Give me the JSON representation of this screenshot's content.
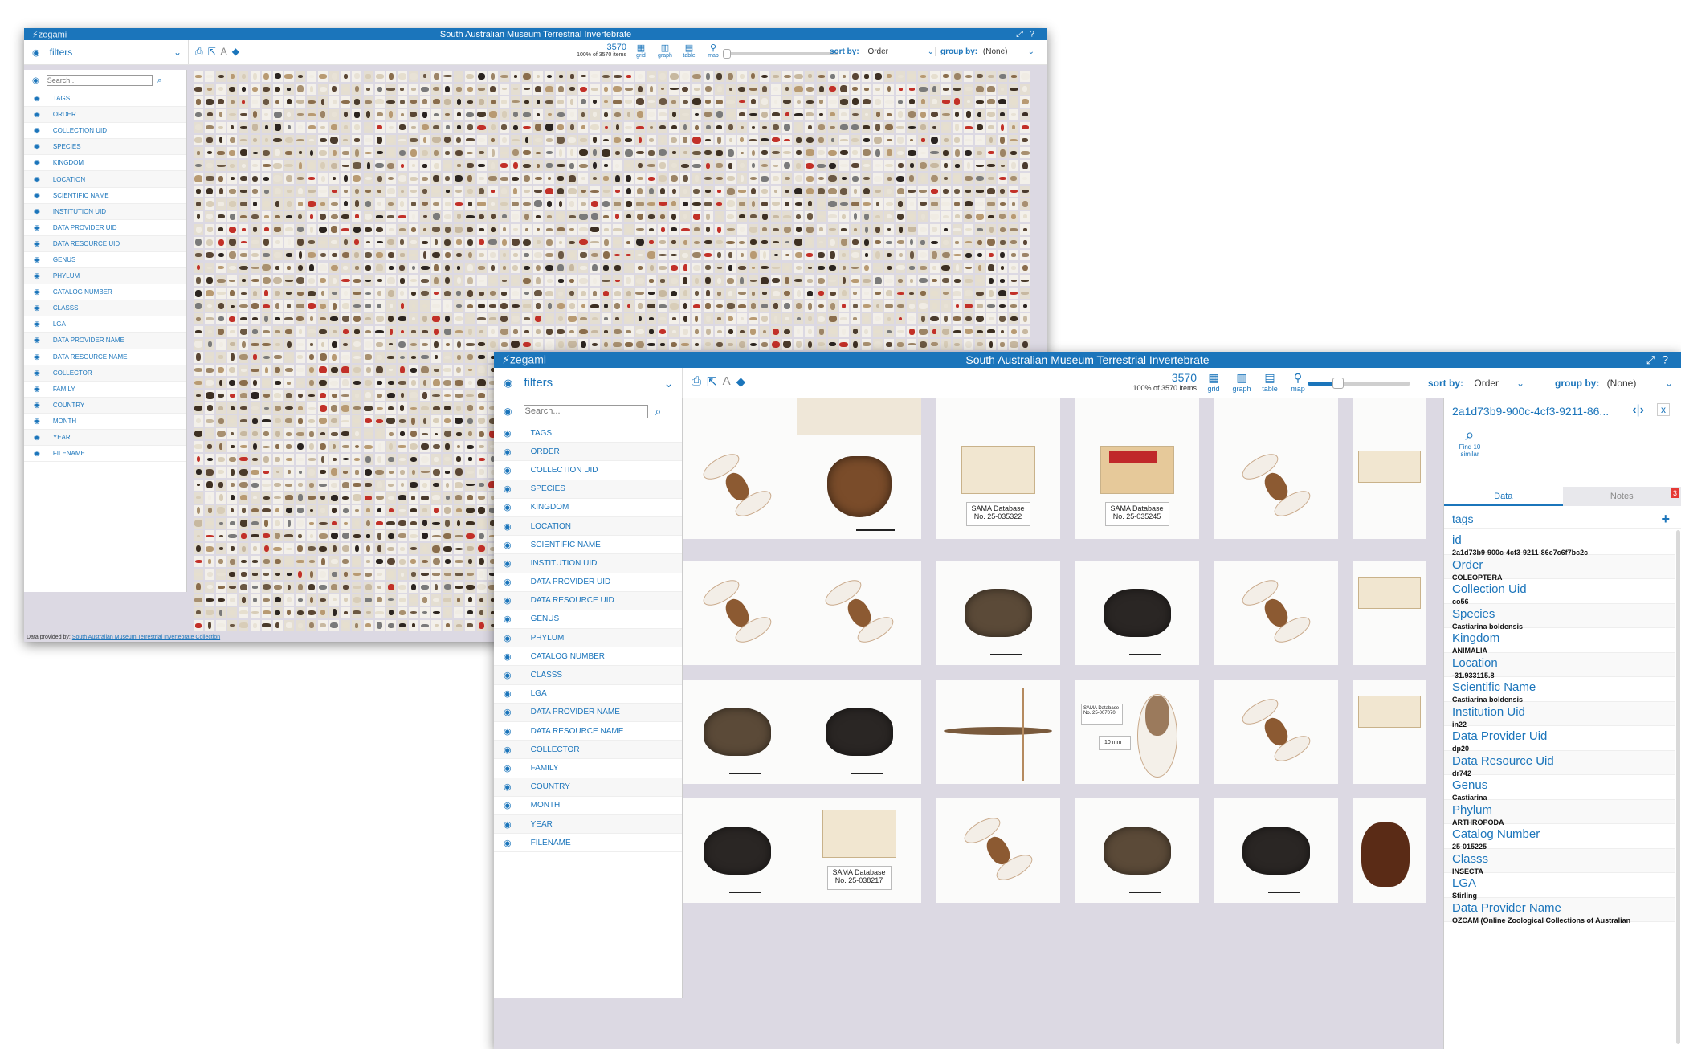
{
  "back": {
    "logo": "zegami",
    "title": "South Australian Museum Terrestrial Invertebrate",
    "filters_label": "filters",
    "search_placeholder": "Search...",
    "count": "3570",
    "count_sub": "100% of 3570 items",
    "views": [
      "grid",
      "graph",
      "table",
      "map"
    ],
    "sort_label": "sort by:",
    "sort_value": "Order",
    "group_label": "group by:",
    "group_value": "(None)",
    "footer_prefix": "Data provided by:",
    "footer_link": "South Australian Museum Terrestrial Invertebrate Collection"
  },
  "front": {
    "logo": "zegami",
    "title": "South Australian Museum Terrestrial Invertebrate",
    "filters_label": "filters",
    "search_placeholder": "Search...",
    "count": "3570",
    "count_sub": "100% of 3570 items",
    "views": [
      "grid",
      "graph",
      "table",
      "map"
    ],
    "sort_label": "sort by:",
    "sort_value": "Order",
    "group_label": "group by:",
    "group_value": "(None)"
  },
  "filters": [
    "TAGS",
    "ORDER",
    "COLLECTION UID",
    "SPECIES",
    "KINGDOM",
    "LOCATION",
    "SCIENTIFIC NAME",
    "INSTITUTION UID",
    "DATA PROVIDER UID",
    "DATA RESOURCE UID",
    "GENUS",
    "PHYLUM",
    "CATALOG NUMBER",
    "CLASSS",
    "LGA",
    "DATA PROVIDER NAME",
    "DATA RESOURCE NAME",
    "COLLECTOR",
    "FAMILY",
    "COUNTRY",
    "MONTH",
    "YEAR",
    "FILENAME"
  ],
  "specimen_labels": {
    "sama1": "SAMA Database",
    "sama1_no": "No. 25-035322",
    "sama2": "SAMA Database",
    "sama2_no": "No. 25-035245",
    "sama3": "SAMA Database",
    "sama3_no": "No. 25-038217",
    "top_label": "SAMA Database",
    "top_no": "No. 25-007070",
    "scale": "10 mm"
  },
  "detail": {
    "record_id": "2a1d73b9-900c-4cf3-9211-86...",
    "find_similar": "Find 10 similar",
    "tab_data": "Data",
    "tab_notes": "Notes",
    "notes_count": "3",
    "tags_label": "tags",
    "fields": [
      {
        "key": "id",
        "value": "2a1d73b9-900c-4cf3-9211-86e7c6f7bc2c"
      },
      {
        "key": "Order",
        "value": "COLEOPTERA"
      },
      {
        "key": "Collection Uid",
        "value": "co56"
      },
      {
        "key": "Species",
        "value": "Castiarina boldensis"
      },
      {
        "key": "Kingdom",
        "value": "ANIMALIA"
      },
      {
        "key": "Location",
        "value": "-31.933115.8"
      },
      {
        "key": "Scientific Name",
        "value": "Castiarina boldensis"
      },
      {
        "key": "Institution Uid",
        "value": "in22"
      },
      {
        "key": "Data Provider Uid",
        "value": "dp20"
      },
      {
        "key": "Data Resource Uid",
        "value": "dr742"
      },
      {
        "key": "Genus",
        "value": "Castiarina"
      },
      {
        "key": "Phylum",
        "value": "ARTHROPODA"
      },
      {
        "key": "Catalog Number",
        "value": "25-015225"
      },
      {
        "key": "Classs",
        "value": "INSECTA"
      },
      {
        "key": "LGA",
        "value": "Stirling"
      },
      {
        "key": "Data Provider Name",
        "value": "OZCAM (Online Zoological Collections of Australian"
      }
    ]
  },
  "colors": {
    "accent": "#1b75bb",
    "titlebar": "#1b75bb",
    "grid_bg": "#dcd9e3",
    "notes_badge": "#e53935"
  }
}
